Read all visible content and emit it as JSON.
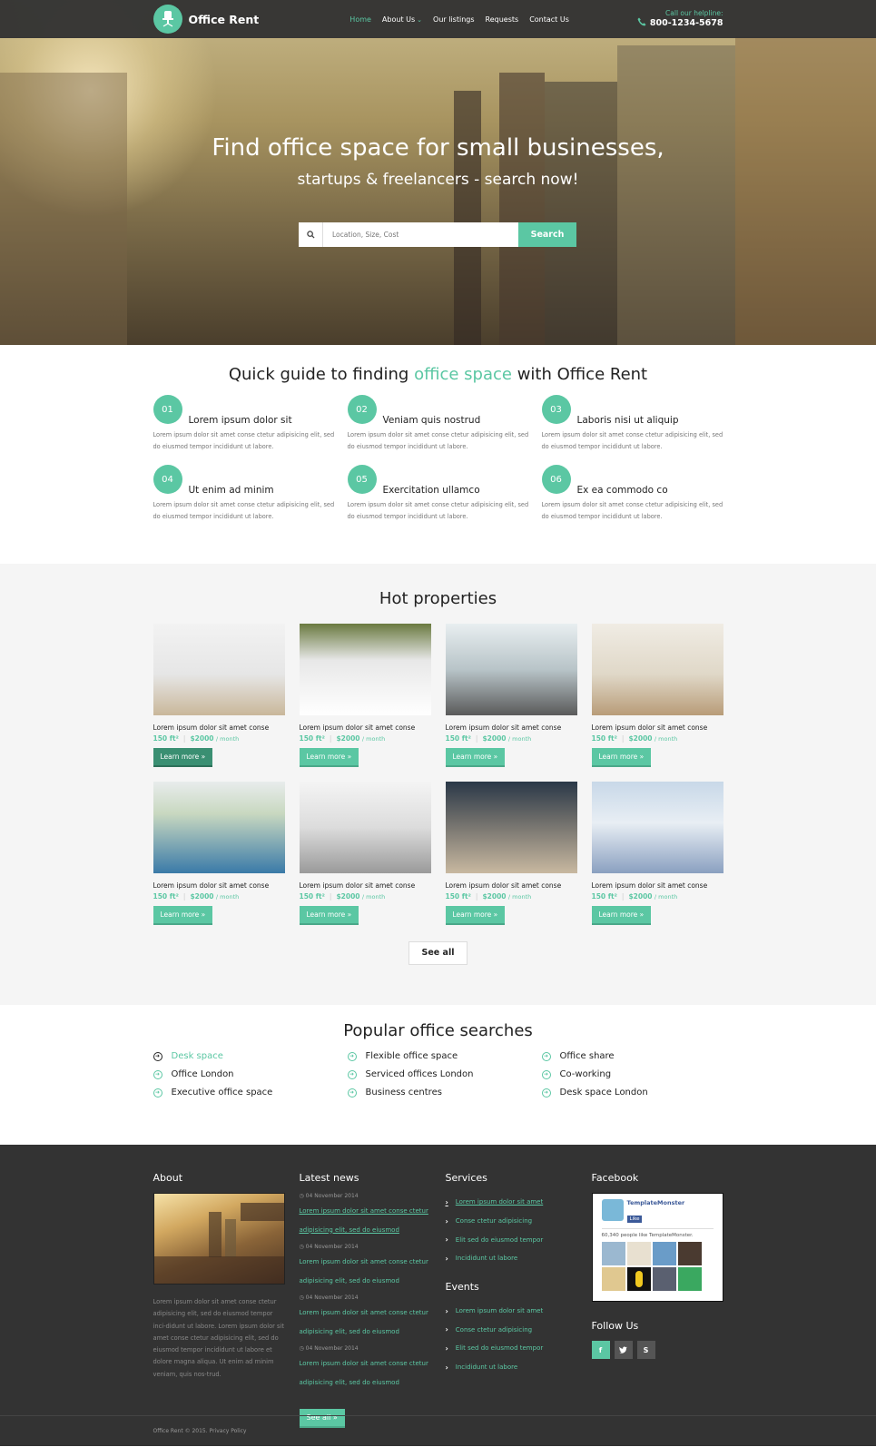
{
  "header": {
    "brand": "Office Rent",
    "logo_icon": "office-chair-icon",
    "nav": [
      {
        "label": "Home",
        "active": true
      },
      {
        "label": "About Us",
        "has_dropdown": true
      },
      {
        "label": "Our listings"
      },
      {
        "label": "Requests"
      },
      {
        "label": "Contact Us"
      }
    ],
    "helpline_label": "Call our helpline:",
    "helpline_number": "800-1234-5678",
    "phone_icon": "phone-icon"
  },
  "hero": {
    "title": "Find office space for small businesses,",
    "subtitle": "startups & freelancers - search now!",
    "search_placeholder": "Location, Size, Cost",
    "search_button": "Search",
    "search_icon": "search-icon"
  },
  "guide": {
    "title_pre": "Quick guide to finding ",
    "title_highlight": "office space",
    "title_post": " with Office Rent",
    "steps": [
      {
        "num": "01",
        "title": "Lorem ipsum dolor sit",
        "text": "Lorem ipsum dolor sit amet conse ctetur adipisicing elit, sed do eiusmod tempor incididunt ut labore."
      },
      {
        "num": "02",
        "title": "Veniam quis nostrud",
        "text": "Lorem ipsum dolor sit amet conse ctetur adipisicing elit, sed do eiusmod tempor incididunt ut labore."
      },
      {
        "num": "03",
        "title": "Laboris nisi ut aliquip",
        "text": "Lorem ipsum dolor sit amet conse ctetur adipisicing elit, sed do eiusmod tempor incididunt ut labore."
      },
      {
        "num": "04",
        "title": "Ut enim ad minim",
        "text": "Lorem ipsum dolor sit amet conse ctetur adipisicing elit, sed do eiusmod tempor incididunt ut labore."
      },
      {
        "num": "05",
        "title": "Exercitation ullamco",
        "text": "Lorem ipsum dolor sit amet conse ctetur adipisicing elit, sed do eiusmod tempor incididunt ut labore."
      },
      {
        "num": "06",
        "title": "Ex ea commodo co",
        "text": "Lorem ipsum dolor sit amet conse ctetur adipisicing elit, sed do eiusmod tempor incididunt ut labore."
      }
    ]
  },
  "hot": {
    "title": "Hot properties",
    "properties": [
      {
        "title": "Lorem ipsum dolor sit amet conse",
        "size": "150 ft²",
        "price": "$2000",
        "period": "/ month",
        "button": "Learn more »"
      },
      {
        "title": "Lorem ipsum dolor sit amet conse",
        "size": "150 ft²",
        "price": "$2000",
        "period": "/ month",
        "button": "Learn more »"
      },
      {
        "title": "Lorem ipsum dolor sit amet conse",
        "size": "150 ft²",
        "price": "$2000",
        "period": "/ month",
        "button": "Learn more »"
      },
      {
        "title": "Lorem ipsum dolor sit amet conse",
        "size": "150 ft²",
        "price": "$2000",
        "period": "/ month",
        "button": "Learn more »"
      },
      {
        "title": "Lorem ipsum dolor sit amet conse",
        "size": "150 ft²",
        "price": "$2000",
        "period": "/ month",
        "button": "Learn more »"
      },
      {
        "title": "Lorem ipsum dolor sit amet conse",
        "size": "150 ft²",
        "price": "$2000",
        "period": "/ month",
        "button": "Learn more »"
      },
      {
        "title": "Lorem ipsum dolor sit amet conse",
        "size": "150 ft²",
        "price": "$2000",
        "period": "/ month",
        "button": "Learn more »"
      },
      {
        "title": "Lorem ipsum dolor sit amet conse",
        "size": "150 ft²",
        "price": "$2000",
        "period": "/ month",
        "button": "Learn more »"
      }
    ],
    "see_all": "See all"
  },
  "popular": {
    "title": "Popular office searches",
    "items": [
      {
        "label": "Desk space",
        "active": true
      },
      {
        "label": "Flexible office space"
      },
      {
        "label": "Office share"
      },
      {
        "label": "Office London"
      },
      {
        "label": "Serviced offices London"
      },
      {
        "label": "Co-working"
      },
      {
        "label": "Executive office space"
      },
      {
        "label": "Business centres"
      },
      {
        "label": "Desk space London"
      }
    ]
  },
  "footer": {
    "about_title": "About",
    "about_text": "Lorem ipsum dolor sit amet conse ctetur adipisicing elit, sed do eiusmod tempor inci-didunt ut labore. Lorem ipsum dolor sit amet conse ctetur adipisicing elit, sed do eiusmod tempor incididunt ut labore et dolore magna aliqua. Ut enim ad minim veniam, quis nos-trud.",
    "news_title": "Latest news",
    "news": [
      {
        "date": "04 November 2014",
        "text": "Lorem ipsum dolor sit amet conse ctetur adipisicing elit, sed do eiusmod"
      },
      {
        "date": "04 November 2014",
        "text": "Lorem ipsum dolor sit amet conse ctetur adipisicing elit, sed do eiusmod"
      },
      {
        "date": "04 November 2014",
        "text": "Lorem ipsum dolor sit amet conse ctetur adipisicing elit, sed do eiusmod"
      },
      {
        "date": "04 November 2014",
        "text": "Lorem ipsum dolor sit amet conse ctetur adipisicing elit, sed do eiusmod"
      }
    ],
    "news_see_all": "See all »",
    "services_title": "Services",
    "services": [
      "Lorem ipsum dolor sit amet",
      "Conse ctetur adipisicing",
      "Elit sed do eiusmod tempor",
      "Incididunt ut labore"
    ],
    "events_title": "Events",
    "events": [
      "Lorem ipsum dolor sit amet",
      "Conse ctetur adipisicing",
      "Elit sed do eiusmod tempor",
      "Incididunt ut labore"
    ],
    "facebook_title": "Facebook",
    "fb_page": "TemplateMonster",
    "fb_like": "Like",
    "fb_count": "60,340 people like TemplateMonster.",
    "follow_title": "Follow Us",
    "socials": [
      {
        "name": "facebook",
        "glyph": "f"
      },
      {
        "name": "twitter",
        "glyph": "t"
      },
      {
        "name": "skype",
        "glyph": "S"
      }
    ],
    "copyright": "Office Rent  © 2015.  Privacy Policy"
  },
  "colors": {
    "accent": "#5bc7a3",
    "dark": "#333333",
    "light_bg": "#f5f5f5"
  }
}
